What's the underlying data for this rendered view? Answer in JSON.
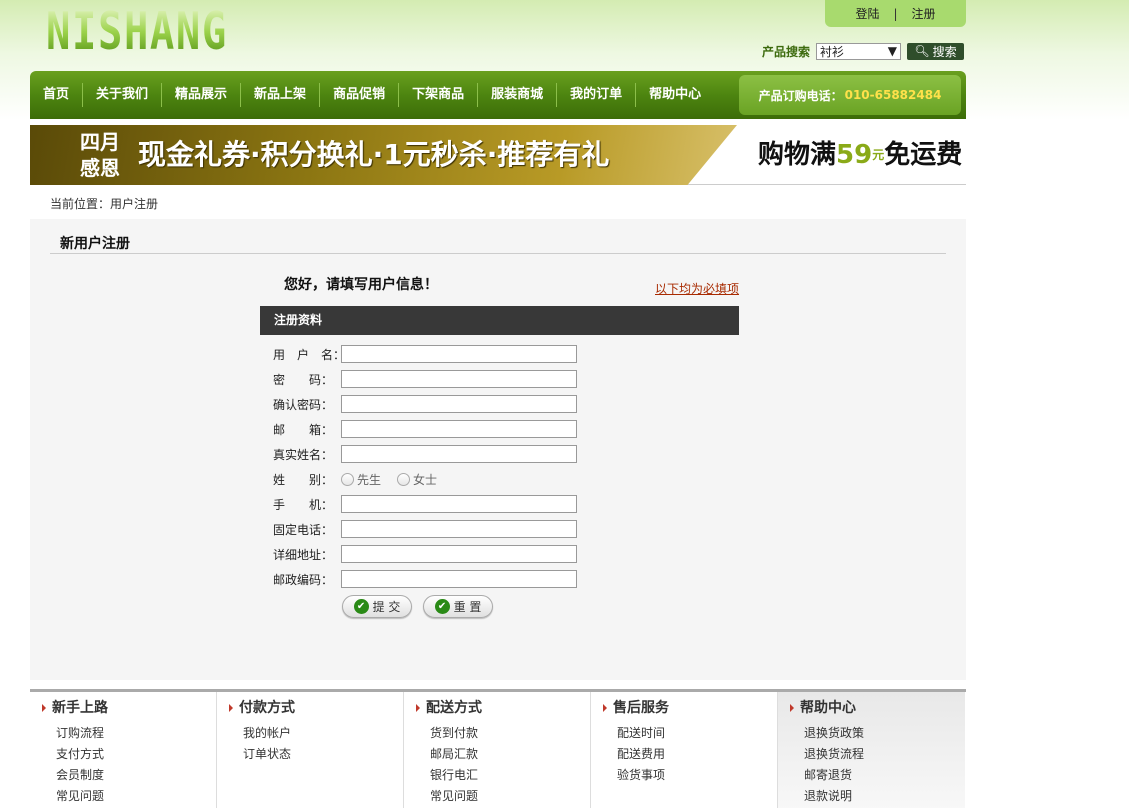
{
  "header": {
    "logo_text": "NISHANG",
    "login_label": "登陆",
    "register_label": "注册",
    "separator": "|",
    "search_label": "产品搜索",
    "search_select_value": "衬衫",
    "search_button_label": "搜索"
  },
  "nav": {
    "items": [
      "首页",
      "关于我们",
      "精品展示",
      "新品上架",
      "商品促销",
      "下架商品",
      "服装商城",
      "我的订单",
      "帮助中心"
    ],
    "phone_label": "产品订购电话：",
    "phone_number": "010-65882484"
  },
  "banner": {
    "badge_line1": "四月",
    "badge_line2": "感恩",
    "main_text": "现金礼券·积分换礼·1元秒杀·推荐有礼",
    "promo_prefix": "购物满",
    "promo_amount": "59",
    "promo_unit": "元",
    "promo_suffix": "免运费"
  },
  "breadcrumb": "当前位置：用户注册",
  "panel": {
    "title": "新用户注册",
    "greeting": "您好，请填写用户信息！",
    "required_note": "以下均为必填项",
    "form_header": "注册资料",
    "fields": [
      "用　户　名：",
      "密　　码：",
      "确认密码：",
      "邮　　箱：",
      "真实姓名：",
      "姓　　别：",
      "手　　机：",
      "固定电话：",
      "详细地址：",
      "邮政编码："
    ],
    "gender_options": [
      "先生",
      "女士"
    ],
    "submit_label": "提 交",
    "reset_label": "重 置"
  },
  "footer": {
    "columns": [
      {
        "title": "新手上路",
        "items": [
          "订购流程",
          "支付方式",
          "会员制度",
          "常见问题"
        ]
      },
      {
        "title": "付款方式",
        "items": [
          "我的帐户",
          "订单状态"
        ]
      },
      {
        "title": "配送方式",
        "items": [
          "货到付款",
          "邮局汇款",
          "银行电汇",
          "常见问题"
        ]
      },
      {
        "title": "售后服务",
        "items": [
          "配送时间",
          "配送费用",
          "验货事项"
        ]
      },
      {
        "title": "帮助中心",
        "items": [
          "退换货政策",
          "退换货流程",
          "邮寄退货",
          "退款说明"
        ]
      }
    ]
  }
}
